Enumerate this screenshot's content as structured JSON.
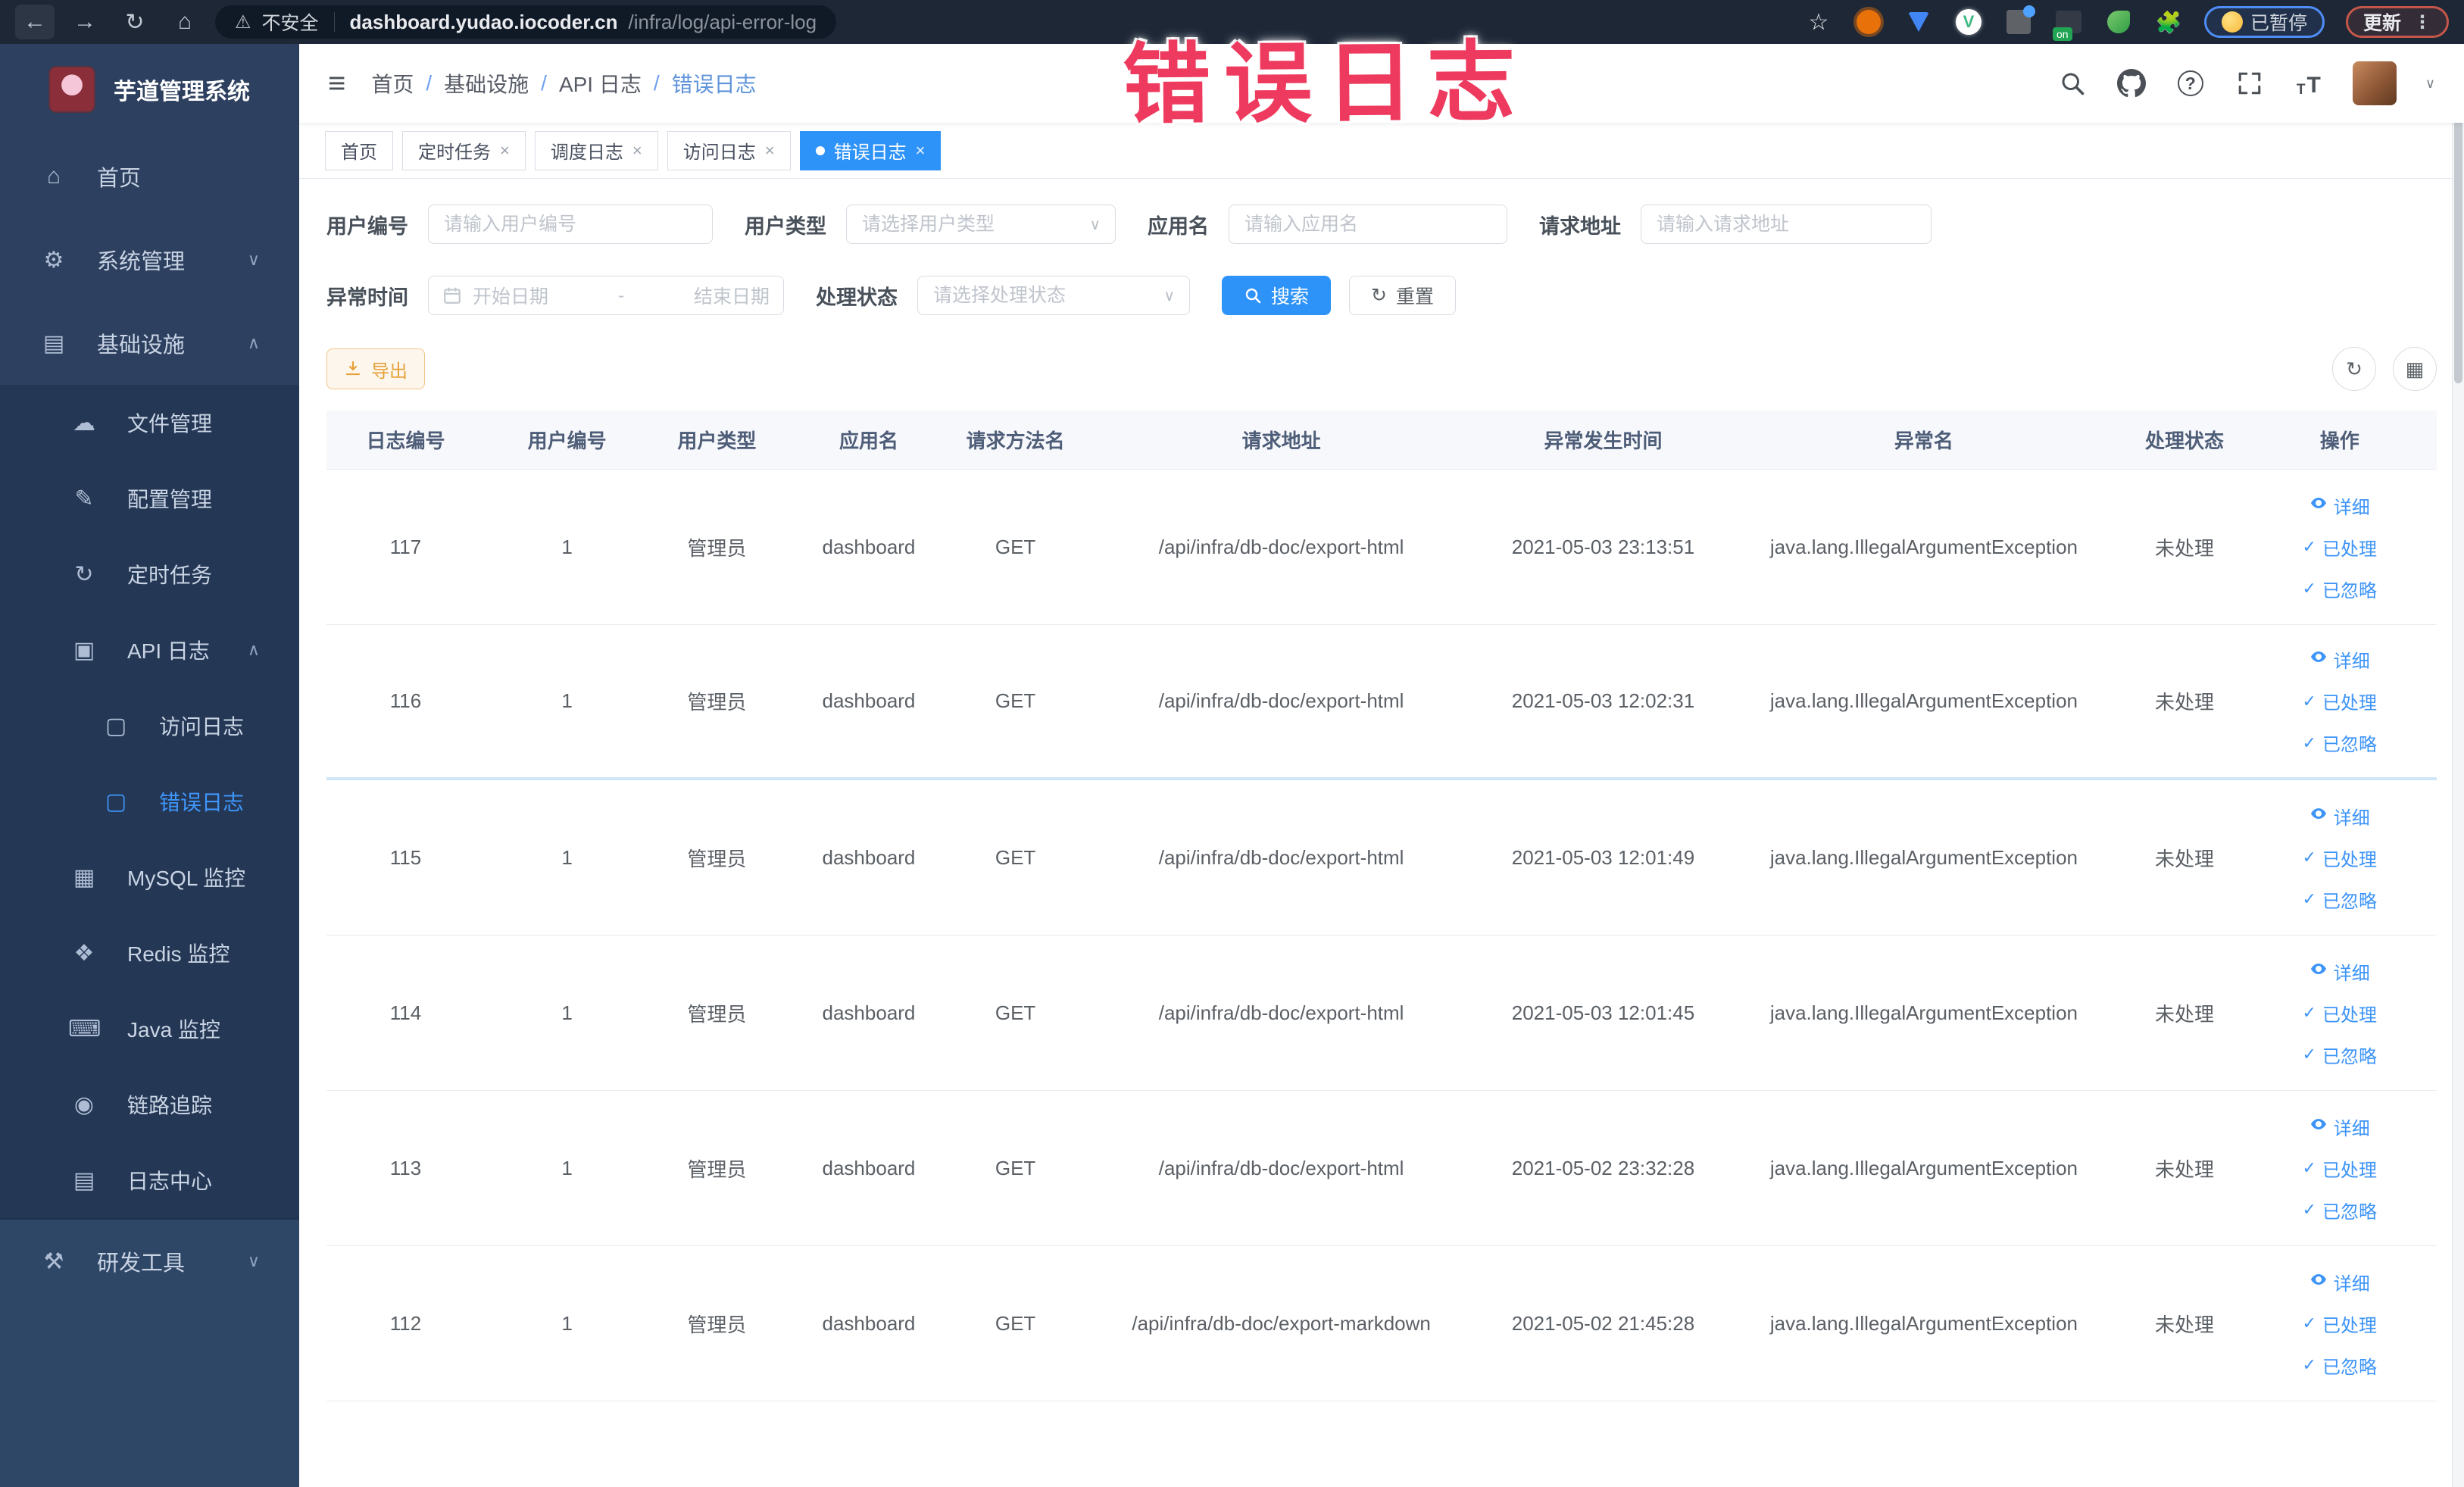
{
  "theme": {
    "accent": "#2e93f8",
    "warning": "#e6a23c",
    "annotation_color": "#ee3a5e",
    "browser_bar_bg": "#1d2736",
    "sidebar_bg": "#2d405f",
    "sidebar_submenu_bg": "#243755",
    "sidebar_dev_bg": "#2f4766"
  },
  "annotation": {
    "text": "错误日志"
  },
  "browser": {
    "security_label": "不安全",
    "url_domain": "dashboard.yudao.iocoder.cn",
    "url_path": "/infra/log/api-error-log",
    "on_badge": "on",
    "paused_label": "已暂停",
    "update_label": "更新"
  },
  "sidebar": {
    "title": "芋道管理系统",
    "sections": [
      {
        "id": "main",
        "items": [
          {
            "key": "home",
            "label": "首页",
            "icon": "home-icon",
            "level": 1
          },
          {
            "key": "system-management",
            "label": "系统管理",
            "icon": "gear-icon",
            "level": 1,
            "chevron": "down"
          },
          {
            "key": "infrastructure",
            "label": "基础设施",
            "icon": "infra-icon",
            "level": 1,
            "chevron": "up"
          }
        ]
      },
      {
        "id": "sub",
        "items": [
          {
            "key": "file-management",
            "label": "文件管理",
            "icon": "cloud-upload-icon",
            "level": 2
          },
          {
            "key": "config-management",
            "label": "配置管理",
            "icon": "edit-icon",
            "level": 2
          },
          {
            "key": "scheduled-tasks",
            "label": "定时任务",
            "icon": "timer-icon",
            "level": 2
          },
          {
            "key": "api-log",
            "label": "API 日志",
            "icon": "log-icon",
            "level": 2,
            "chevron": "up"
          },
          {
            "key": "access-log",
            "label": "访问日志",
            "icon": "doc-icon",
            "level": 3
          },
          {
            "key": "error-log",
            "label": "错误日志",
            "icon": "doc-icon",
            "level": 3,
            "active": true
          },
          {
            "key": "mysql-monitor",
            "label": "MySQL 监控",
            "icon": "mysql-icon",
            "level": 2
          },
          {
            "key": "redis-monitor",
            "label": "Redis 监控",
            "icon": "redis-icon",
            "level": 2
          },
          {
            "key": "java-monitor",
            "label": "Java 监控",
            "icon": "java-icon",
            "level": 2
          },
          {
            "key": "trace",
            "label": "链路追踪",
            "icon": "trace-icon",
            "level": 2
          },
          {
            "key": "log-center",
            "label": "日志中心",
            "icon": "log-center-icon",
            "level": 2
          }
        ]
      },
      {
        "id": "dev",
        "items": [
          {
            "key": "dev-tools",
            "label": "研发工具",
            "icon": "tools-icon",
            "level": 1,
            "chevron": "down"
          }
        ]
      }
    ]
  },
  "breadcrumb": {
    "items": [
      "首页",
      "基础设施",
      "API 日志",
      "错误日志"
    ]
  },
  "tabs": [
    {
      "key": "home",
      "label": "首页",
      "closable": false,
      "active": false
    },
    {
      "key": "scheduled-tasks",
      "label": "定时任务",
      "closable": true,
      "active": false
    },
    {
      "key": "schedule-log",
      "label": "调度日志",
      "closable": true,
      "active": false
    },
    {
      "key": "access-log",
      "label": "访问日志",
      "closable": true,
      "active": false
    },
    {
      "key": "error-log",
      "label": "错误日志",
      "closable": true,
      "active": true
    }
  ],
  "filters": {
    "user_id": {
      "label": "用户编号",
      "placeholder": "请输入用户编号",
      "value": ""
    },
    "user_type": {
      "label": "用户类型",
      "placeholder": "请选择用户类型",
      "value": ""
    },
    "app_name": {
      "label": "应用名",
      "placeholder": "请输入应用名",
      "value": ""
    },
    "request_url": {
      "label": "请求地址",
      "placeholder": "请输入请求地址",
      "value": ""
    },
    "exception_time": {
      "label": "异常时间",
      "start_placeholder": "开始日期",
      "separator": "-",
      "end_placeholder": "结束日期"
    },
    "process_status": {
      "label": "处理状态",
      "placeholder": "请选择处理状态",
      "value": ""
    },
    "search_label": "搜索",
    "reset_label": "重置"
  },
  "toolbar": {
    "export_label": "导出"
  },
  "table": {
    "columns": [
      "日志编号",
      "用户编号",
      "用户类型",
      "应用名",
      "请求方法名",
      "请求地址",
      "异常发生时间",
      "异常名",
      "处理状态",
      "操作"
    ],
    "actions": [
      "详细",
      "已处理",
      "已忽略"
    ],
    "divider_highlight_after": "116",
    "rows": [
      {
        "id": "117",
        "user_id": "1",
        "user_type": "管理员",
        "app": "dashboard",
        "method": "GET",
        "url": "/api/infra/db-doc/export-html",
        "time": "2021-05-03 23:13:51",
        "exception": "java.lang.IllegalArgumentException",
        "status": "未处理"
      },
      {
        "id": "116",
        "user_id": "1",
        "user_type": "管理员",
        "app": "dashboard",
        "method": "GET",
        "url": "/api/infra/db-doc/export-html",
        "time": "2021-05-03 12:02:31",
        "exception": "java.lang.IllegalArgumentException",
        "status": "未处理"
      },
      {
        "id": "115",
        "user_id": "1",
        "user_type": "管理员",
        "app": "dashboard",
        "method": "GET",
        "url": "/api/infra/db-doc/export-html",
        "time": "2021-05-03 12:01:49",
        "exception": "java.lang.IllegalArgumentException",
        "status": "未处理"
      },
      {
        "id": "114",
        "user_id": "1",
        "user_type": "管理员",
        "app": "dashboard",
        "method": "GET",
        "url": "/api/infra/db-doc/export-html",
        "time": "2021-05-03 12:01:45",
        "exception": "java.lang.IllegalArgumentException",
        "status": "未处理"
      },
      {
        "id": "113",
        "user_id": "1",
        "user_type": "管理员",
        "app": "dashboard",
        "method": "GET",
        "url": "/api/infra/db-doc/export-html",
        "time": "2021-05-02 23:32:28",
        "exception": "java.lang.IllegalArgumentException",
        "status": "未处理"
      },
      {
        "id": "112",
        "user_id": "1",
        "user_type": "管理员",
        "app": "dashboard",
        "method": "GET",
        "url": "/api/infra/db-doc/export-markdown",
        "time": "2021-05-02 21:45:28",
        "exception": "java.lang.IllegalArgumentException",
        "status": "未处理"
      }
    ]
  }
}
